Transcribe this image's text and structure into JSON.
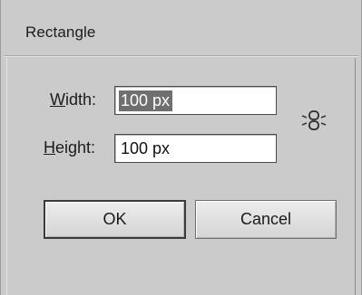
{
  "dialog": {
    "title": "Rectangle"
  },
  "fields": {
    "width": {
      "label_mnemonic": "W",
      "label_rest": "idth:",
      "value": "100 px"
    },
    "height": {
      "label_mnemonic": "H",
      "label_rest": "eight:",
      "value": "100 px"
    }
  },
  "link_icon": "constrain-proportions-link-icon",
  "buttons": {
    "ok": "OK",
    "cancel": "Cancel"
  }
}
